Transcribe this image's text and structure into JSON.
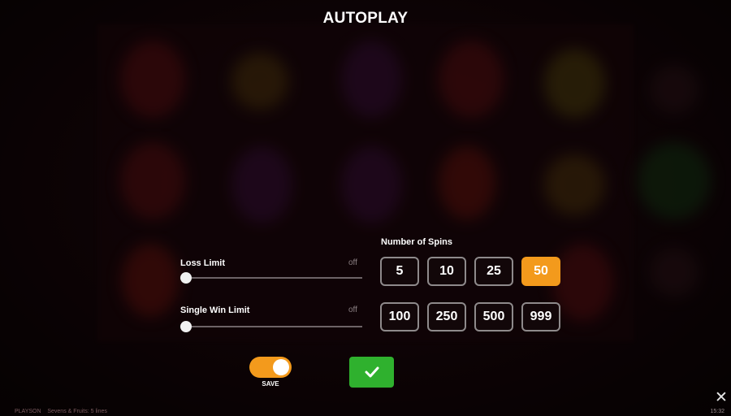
{
  "title": "AUTOPLAY",
  "loss_limit": {
    "label": "Loss Limit",
    "state": "off",
    "value_fraction": 0
  },
  "single_win_limit": {
    "label": "Single Win Limit",
    "state": "off",
    "value_fraction": 0
  },
  "number_of_spins": {
    "label": "Number of Spins",
    "options": [
      "5",
      "10",
      "25",
      "50",
      "100",
      "250",
      "500",
      "999"
    ],
    "selected": "50"
  },
  "save": {
    "label": "SAVE",
    "toggle_on": true
  },
  "confirm_icon": "check-icon",
  "close_icon": "close-icon",
  "footer": {
    "provider": "PLAYSON",
    "game_name": "Sevens & Fruits: 5 lines"
  },
  "clock": "15:32",
  "colors": {
    "accent": "#f39a1c",
    "confirm": "#2fb12e",
    "background": "#17060a"
  }
}
